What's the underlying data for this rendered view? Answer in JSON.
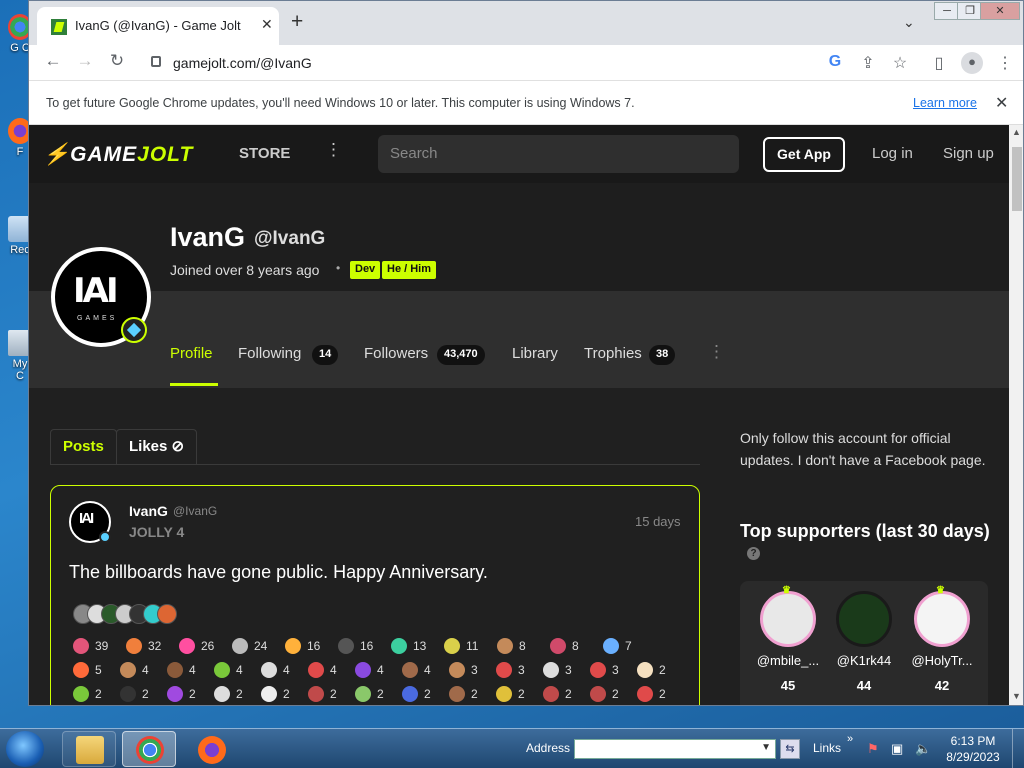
{
  "desktop": {
    "icons": [
      {
        "label": "G C",
        "icon": "chrome-icon"
      },
      {
        "label": "F",
        "icon": "firefox-icon"
      },
      {
        "label": "Rec",
        "icon": "recycle-bin-icon"
      },
      {
        "label": "My C",
        "icon": "my-computer-icon"
      }
    ]
  },
  "browser": {
    "tab_title": "IvanG (@IvanG) - Game Jolt",
    "url": "gamejolt.com/@IvanG",
    "window_controls": {
      "minimize": "─",
      "maximize": "❐",
      "close": "✕"
    },
    "infobar": {
      "message": "To get future Google Chrome updates, you'll need Windows 10 or later. This computer is using Windows 7.",
      "link": "Learn more"
    }
  },
  "site": {
    "logo_game": "GAME",
    "logo_jolt": "JOLT",
    "store": "STORE",
    "search_placeholder": "Search",
    "get_app": "Get App",
    "login": "Log in",
    "signup": "Sign up"
  },
  "profile": {
    "name": "IvanG",
    "handle": "@IvanG",
    "joined": "Joined over 8 years ago",
    "tags": [
      "Dev",
      "He / Him"
    ],
    "avatar_text": "IAI",
    "avatar_sub": "GAMES",
    "tabs": [
      {
        "label": "Profile",
        "count": null
      },
      {
        "label": "Following",
        "count": "14"
      },
      {
        "label": "Followers",
        "count": "43,470"
      },
      {
        "label": "Library",
        "count": null
      },
      {
        "label": "Trophies",
        "count": "38"
      }
    ]
  },
  "feed": {
    "tabs": [
      "Posts",
      "Likes"
    ],
    "post": {
      "author": "IvanG",
      "handle": "@IvanG",
      "game": "JOLLY 4",
      "time": "15 days",
      "text": "The billboards have gone public. Happy Anniversary.",
      "stickers_row1": [
        {
          "count": "39",
          "color": "#e2557a"
        },
        {
          "count": "32",
          "color": "#f07f3c"
        },
        {
          "count": "26",
          "color": "#ff4fa0"
        },
        {
          "count": "24",
          "color": "#bbbbbb"
        },
        {
          "count": "16",
          "color": "#ffb13b"
        },
        {
          "count": "16",
          "color": "#555555"
        },
        {
          "count": "13",
          "color": "#3ccf9f"
        },
        {
          "count": "11",
          "color": "#d9d04a"
        },
        {
          "count": "8",
          "color": "#c48a5a"
        },
        {
          "count": "8",
          "color": "#d04a6a"
        },
        {
          "count": "7",
          "color": "#6ab0ff"
        }
      ],
      "stickers_row2": [
        {
          "count": "5",
          "color": "#ff6a3a"
        },
        {
          "count": "4",
          "color": "#c48a5a"
        },
        {
          "count": "4",
          "color": "#8a5a3a"
        },
        {
          "count": "4",
          "color": "#7ac83a"
        },
        {
          "count": "4",
          "color": "#dddddd"
        },
        {
          "count": "4",
          "color": "#e04a4a"
        },
        {
          "count": "4",
          "color": "#8a4ae0"
        },
        {
          "count": "4",
          "color": "#a06a4a"
        },
        {
          "count": "3",
          "color": "#c48a5a"
        },
        {
          "count": "3",
          "color": "#e04a4a"
        },
        {
          "count": "3",
          "color": "#dddddd"
        },
        {
          "count": "3",
          "color": "#e04a4a"
        },
        {
          "count": "2",
          "color": "#f5e0c0"
        }
      ],
      "stickers_row3": [
        {
          "count": "2",
          "color": "#7ac83a"
        },
        {
          "count": "2",
          "color": "#333333"
        },
        {
          "count": "2",
          "color": "#a04ae0"
        },
        {
          "count": "2",
          "color": "#dddddd"
        },
        {
          "count": "2",
          "color": "#eeeeee"
        },
        {
          "count": "2",
          "color": "#c04a4a"
        },
        {
          "count": "2",
          "color": "#8ac86a"
        },
        {
          "count": "2",
          "color": "#4a6ae0"
        },
        {
          "count": "2",
          "color": "#a06a4a"
        },
        {
          "count": "2",
          "color": "#e0c03a"
        },
        {
          "count": "2",
          "color": "#c04a4a"
        },
        {
          "count": "2",
          "color": "#c04a4a"
        },
        {
          "count": "2",
          "color": "#e04a4a"
        }
      ]
    }
  },
  "sidebar": {
    "description": "Only follow this account for official updates. I don't have a Facebook page.",
    "supporters_title": "Top supporters (last 30 days)",
    "supporters": [
      {
        "name": "@mbile_...",
        "value": "45",
        "color": "#e8e8e8"
      },
      {
        "name": "@K1rk44",
        "value": "44",
        "color": "#1a3a1a"
      },
      {
        "name": "@HolyTr...",
        "value": "42",
        "color": "#f4f4f4"
      }
    ]
  },
  "taskbar": {
    "address_label": "Address",
    "links_label": "Links",
    "time": "6:13 PM",
    "date": "8/29/2023"
  },
  "colors": {
    "accent": "#ccff00",
    "page_bg": "#202020",
    "nav_bg": "#191919"
  }
}
